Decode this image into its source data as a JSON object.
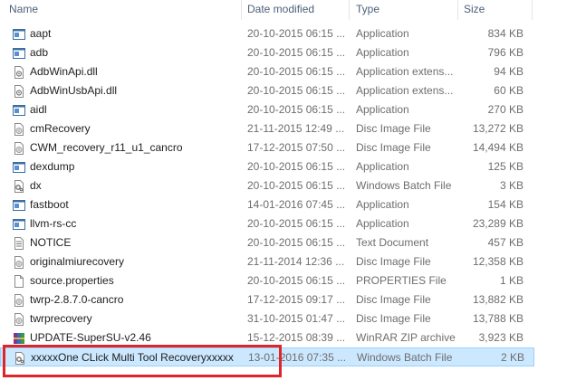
{
  "columns": {
    "name": "Name",
    "date": "Date modified",
    "type": "Type",
    "size": "Size"
  },
  "files": [
    {
      "name": "aapt",
      "date": "20-10-2015 06:15 ...",
      "type": "Application",
      "size": "834 KB",
      "icon": "application-icon"
    },
    {
      "name": "adb",
      "date": "20-10-2015 06:15 ...",
      "type": "Application",
      "size": "796 KB",
      "icon": "application-icon"
    },
    {
      "name": "AdbWinApi.dll",
      "date": "20-10-2015 06:15 ...",
      "type": "Application extens...",
      "size": "94 KB",
      "icon": "dll-file-icon"
    },
    {
      "name": "AdbWinUsbApi.dll",
      "date": "20-10-2015 06:15 ...",
      "type": "Application extens...",
      "size": "60 KB",
      "icon": "dll-file-icon"
    },
    {
      "name": "aidl",
      "date": "20-10-2015 06:15 ...",
      "type": "Application",
      "size": "270 KB",
      "icon": "application-icon"
    },
    {
      "name": "cmRecovery",
      "date": "21-11-2015 12:49 ...",
      "type": "Disc Image File",
      "size": "13,272 KB",
      "icon": "disc-image-icon"
    },
    {
      "name": "CWM_recovery_r11_u1_cancro",
      "date": "17-12-2015 07:50 ...",
      "type": "Disc Image File",
      "size": "14,494 KB",
      "icon": "disc-image-icon"
    },
    {
      "name": "dexdump",
      "date": "20-10-2015 06:15 ...",
      "type": "Application",
      "size": "125 KB",
      "icon": "application-icon"
    },
    {
      "name": "dx",
      "date": "20-10-2015 06:15 ...",
      "type": "Windows Batch File",
      "size": "3 KB",
      "icon": "batch-file-icon"
    },
    {
      "name": "fastboot",
      "date": "14-01-2016 07:45 ...",
      "type": "Application",
      "size": "154 KB",
      "icon": "application-icon"
    },
    {
      "name": "llvm-rs-cc",
      "date": "20-10-2015 06:15 ...",
      "type": "Application",
      "size": "23,289 KB",
      "icon": "application-icon"
    },
    {
      "name": "NOTICE",
      "date": "20-10-2015 06:15 ...",
      "type": "Text Document",
      "size": "457 KB",
      "icon": "text-document-icon"
    },
    {
      "name": "originalmiurecovery",
      "date": "21-11-2014 12:36 ...",
      "type": "Disc Image File",
      "size": "12,358 KB",
      "icon": "disc-image-icon"
    },
    {
      "name": "source.properties",
      "date": "20-10-2015 06:15 ...",
      "type": "PROPERTIES File",
      "size": "1 KB",
      "icon": "generic-file-icon"
    },
    {
      "name": "twrp-2.8.7.0-cancro",
      "date": "17-12-2015 09:17 ...",
      "type": "Disc Image File",
      "size": "13,882 KB",
      "icon": "disc-image-icon"
    },
    {
      "name": "twrprecovery",
      "date": "31-10-2015 01:47 ...",
      "type": "Disc Image File",
      "size": "13,788 KB",
      "icon": "disc-image-icon"
    },
    {
      "name": "UPDATE-SuperSU-v2.46",
      "date": "15-12-2015 08:39 ...",
      "type": "WinRAR ZIP archive",
      "size": "3,923 KB",
      "icon": "winrar-archive-icon"
    },
    {
      "name": "xxxxxOne CLick Multi Tool Recoveryxxxxx",
      "date": "13-01-2016 07:35 ...",
      "type": "Windows Batch File",
      "size": "2 KB",
      "icon": "batch-file-icon",
      "selected": true
    }
  ]
}
